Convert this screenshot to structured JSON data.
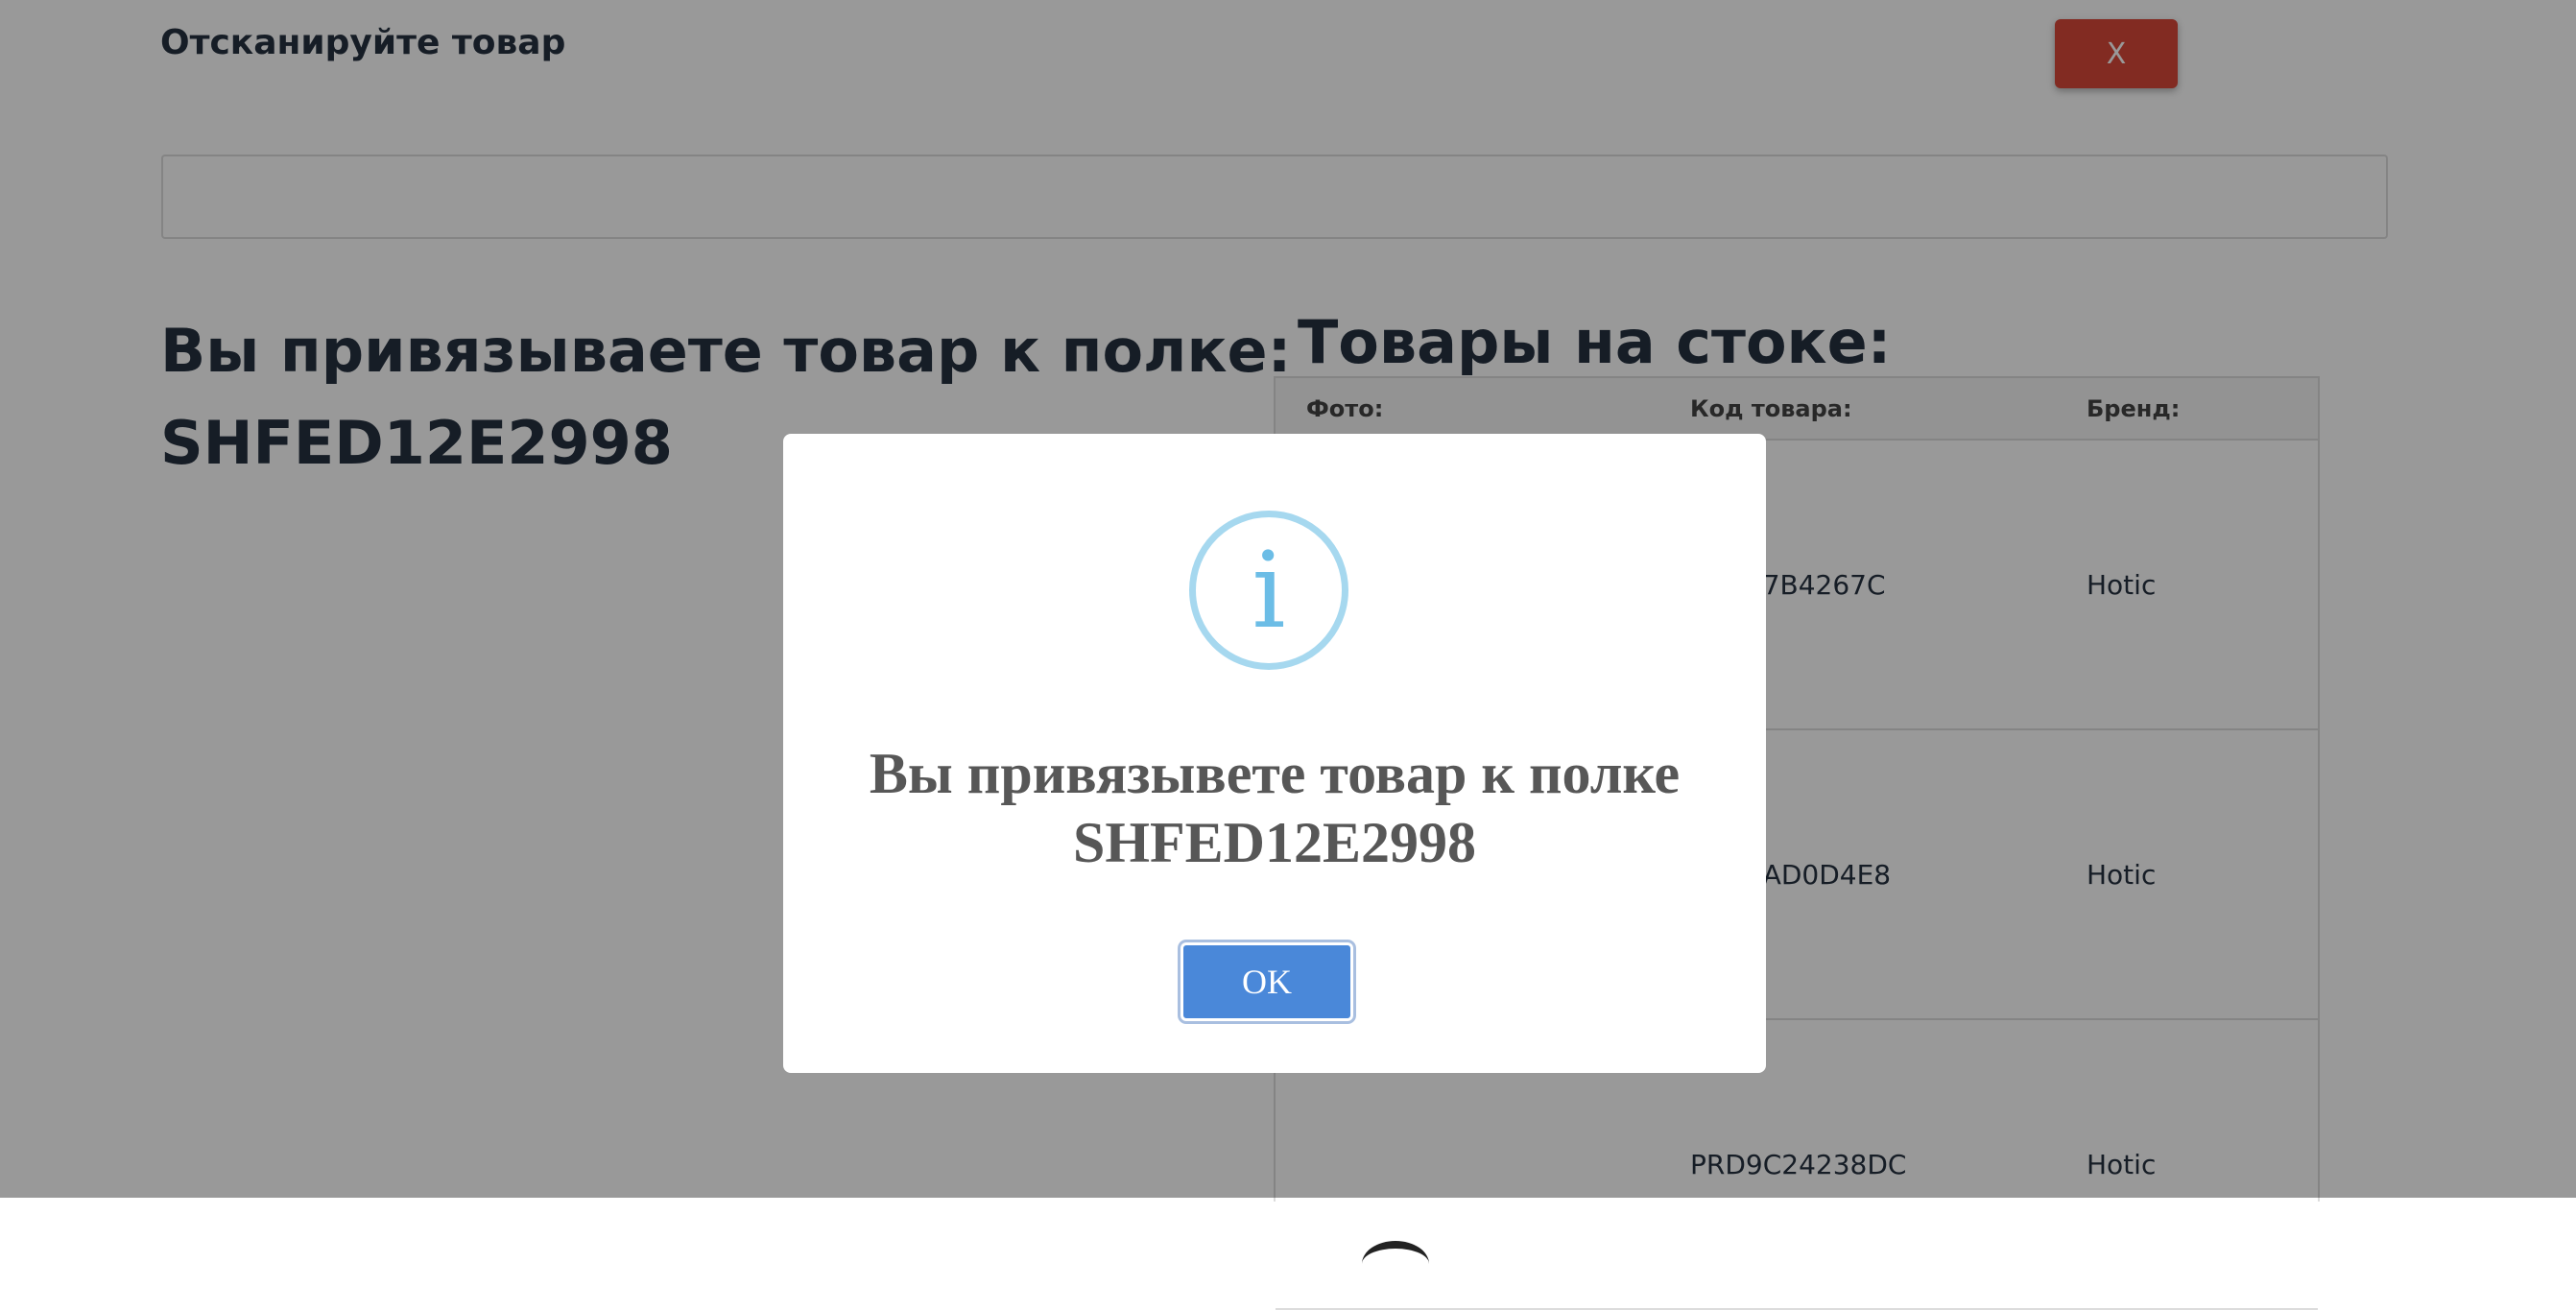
{
  "scan": {
    "title": "Отсканируйте товар",
    "close_label": "X",
    "input_value": ""
  },
  "binding": {
    "heading_line1": "Вы привязываете товар к полке:",
    "heading_line2": "SHFED12E2998"
  },
  "stock": {
    "heading": "Товары на стоке:",
    "columns": [
      "Фото:",
      "Код товара:",
      "Бренд:"
    ],
    "rows": [
      {
        "code": "PRD17B4267C",
        "brand": "Hotic"
      },
      {
        "code": "PRD2AD0D4E8",
        "brand": "Hotic"
      },
      {
        "code": "PRD9C24238DC",
        "brand": "Hotic"
      }
    ]
  },
  "modal": {
    "icon": "info-icon",
    "title_line1": "Вы привязывете товар к полке",
    "title_line2": "SHFED12E2998",
    "ok_label": "OK"
  },
  "colors": {
    "close_button": "#d9483a",
    "ok_button": "#4a88d9",
    "info_icon": "#6cbde6",
    "overlay": "rgba(0,0,0,0.4)"
  }
}
